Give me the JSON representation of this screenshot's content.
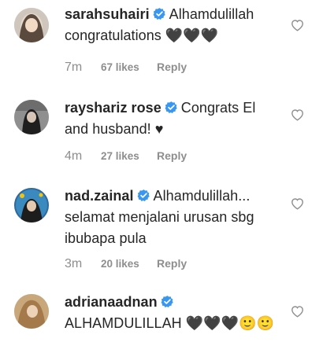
{
  "comments": [
    {
      "username": "sarahsuhairi",
      "verified_icon": "verified-badge-icon",
      "text": "Alhamdulillah congratulations 🖤🖤🖤",
      "time": "7m",
      "likes": "67 likes",
      "reply": "Reply"
    },
    {
      "username": "rayshariz rose",
      "verified_icon": "verified-badge-icon",
      "text": "Congrats El and husband! ♥",
      "time": "4m",
      "likes": "27 likes",
      "reply": "Reply"
    },
    {
      "username": "nad.zainal",
      "verified_icon": "verified-badge-icon",
      "text": "Alhamdulillah... selamat menjalani urusan sbg ibubapa pula",
      "time": "3m",
      "likes": "20 likes",
      "reply": "Reply"
    },
    {
      "username": "adrianaadnan",
      "verified_icon": "verified-badge-icon",
      "text": "ALHAMDULILLAH 🖤🖤🖤🙂🙂",
      "time": "",
      "likes": "",
      "reply": ""
    }
  ],
  "colors": {
    "text": "#262626",
    "meta": "#8e8e8e",
    "verified": "#3897f0",
    "heart_outline": "#8e8e8e"
  }
}
